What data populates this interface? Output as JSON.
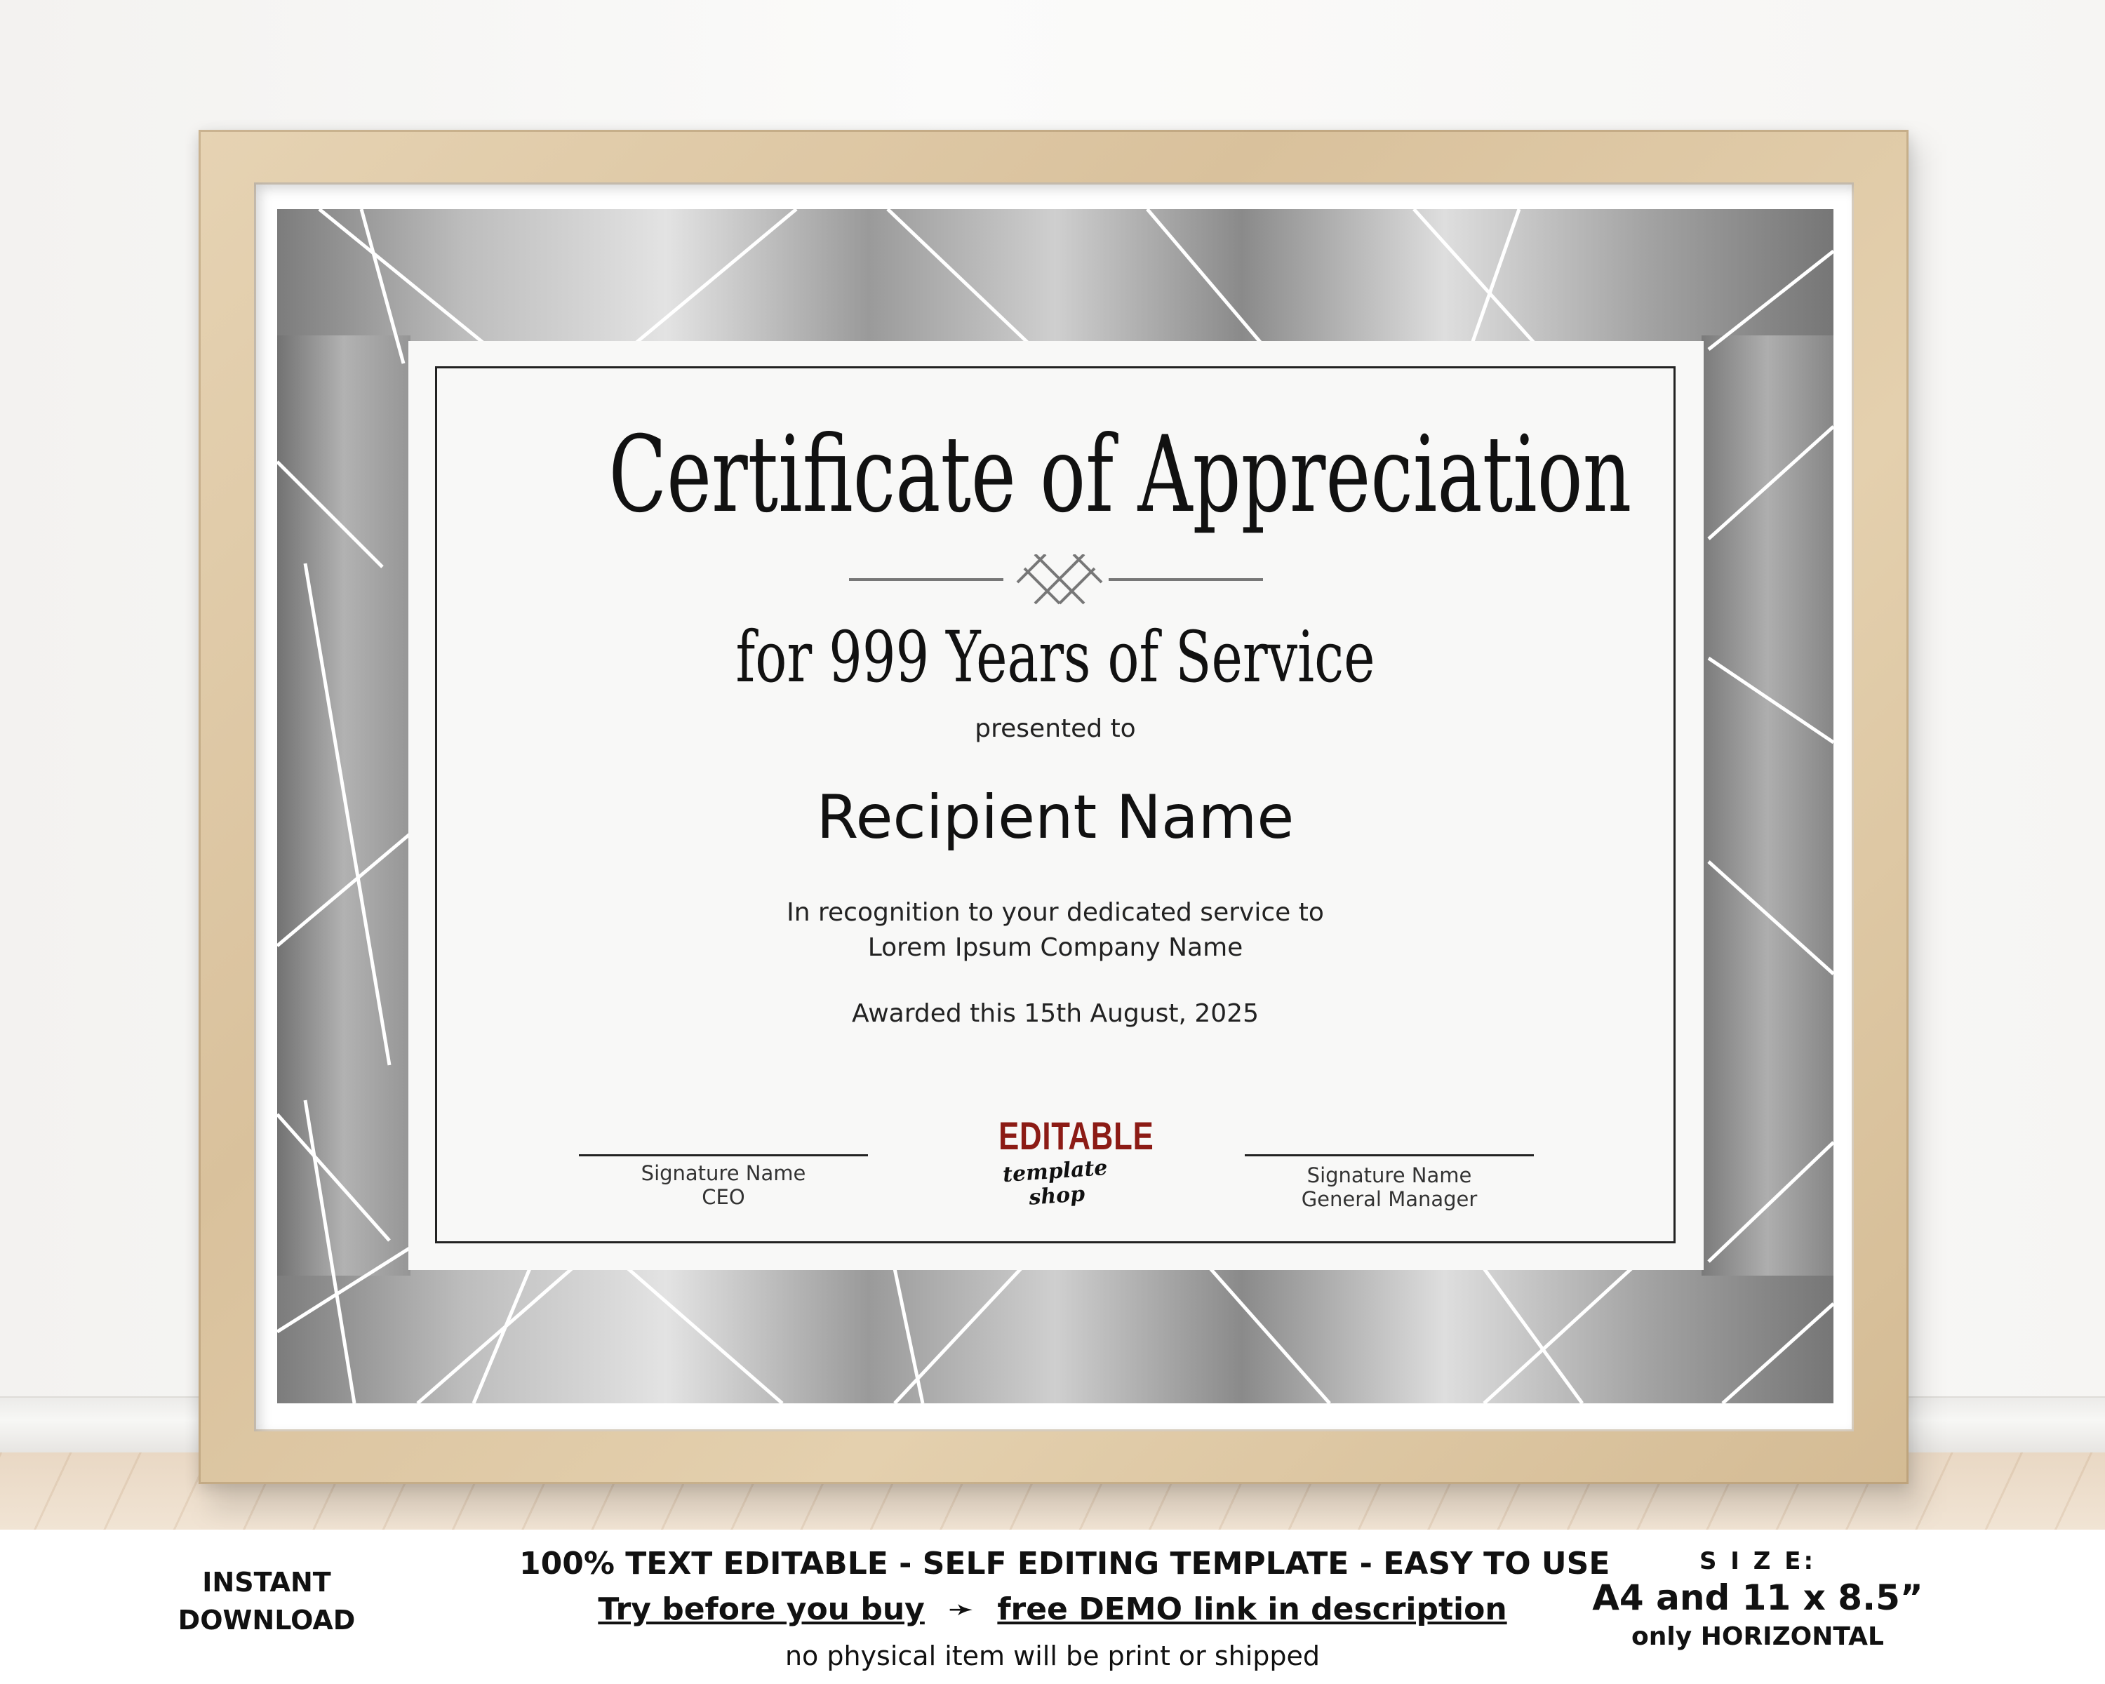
{
  "certificate": {
    "title": "Certificate of Appreciation",
    "subtitle": "for 999 Years of Service",
    "presented_to": "presented to",
    "recipient": "Recipient Name",
    "recognition_line1": "In recognition to your dedicated service to",
    "recognition_line2": "Lorem Ipsum Company Name",
    "awarded": "Awarded this 15th August, 2025",
    "signature_left": {
      "name": "Signature Name",
      "role": "CEO"
    },
    "signature_right": {
      "name": "Signature Name",
      "role": "General Manager"
    },
    "logo_main": "EDITABLE",
    "logo_sub": "template shop"
  },
  "caption": {
    "left_line1": "INSTANT",
    "left_line2": "DOWNLOAD",
    "center_line1": "100% TEXT EDITABLE - SELF EDITING TEMPLATE - EASY TO USE",
    "center_line2_a": "Try before you buy",
    "center_line2_arrow": "➛",
    "center_line2_b": "free DEMO link in description",
    "center_line3": "no physical item will be print or shipped",
    "right_line1": "S I Z E:",
    "right_line2": "A4 and 11 x 8.5”",
    "right_line3": "only HORIZONTAL"
  },
  "colors": {
    "logo_red": "#8c1b15",
    "frame_wood": "#dcc6a2",
    "pattern_gray": "#9a9a9a"
  }
}
